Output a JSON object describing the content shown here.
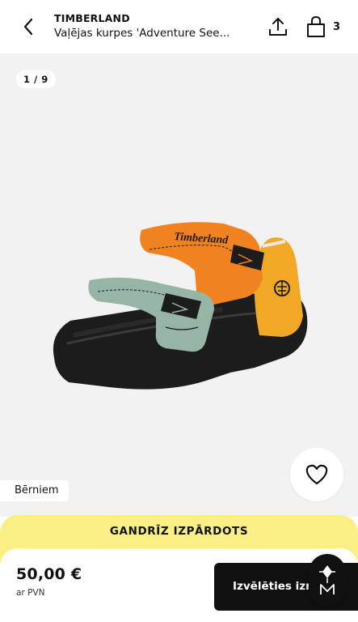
{
  "header": {
    "brand": "TIMBERLAND",
    "product_name": "Vaļējas kurpes 'Adventure See...",
    "bag_count": "3"
  },
  "gallery": {
    "counter": "1 / 9",
    "tag": "Bērniem",
    "shoe_logo": "Timberland"
  },
  "banner": {
    "text": "GANDRĪZ IZPĀRDOTS",
    "color": "#f9ef85"
  },
  "footer": {
    "price": "50,00 €",
    "vat_note": "ar PVN",
    "cta_label": "Izvēlēties izmēru"
  },
  "colors": {
    "orange": "#f0831f",
    "mint": "#97b5a5",
    "yellow": "#f0a825",
    "sole": "#1c1c1c"
  }
}
